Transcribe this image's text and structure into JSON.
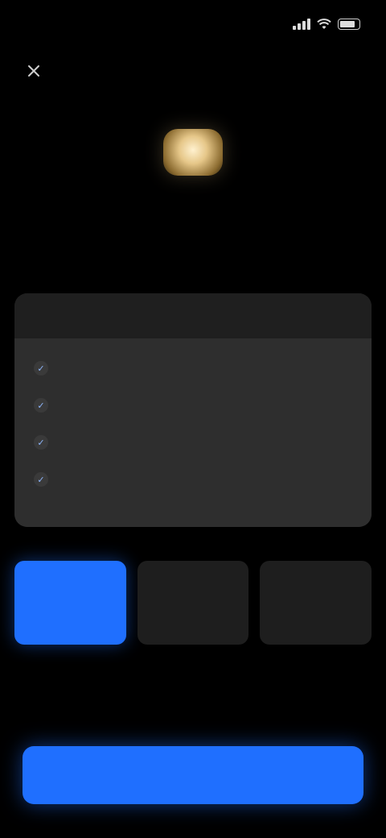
{
  "status_bar": {
    "time": "",
    "signal_bars": 4,
    "battery_level": 0.8
  },
  "nav": {
    "close_icon": "close-icon",
    "title": ""
  },
  "header": {
    "logo_icon": "app-logo-icon",
    "title": "",
    "subtitle": ""
  },
  "benefits": {
    "heading": "",
    "items": [
      {
        "label": ""
      },
      {
        "label": ""
      },
      {
        "label": ""
      },
      {
        "label": ""
      }
    ]
  },
  "plans": [
    {
      "name": "",
      "price": "",
      "selected": true
    },
    {
      "name": "",
      "price": "",
      "selected": false
    },
    {
      "name": "",
      "price": "",
      "selected": false
    }
  ],
  "cta": {
    "label": ""
  },
  "colors": {
    "background": "#000000",
    "accent": "#1f6fff",
    "card": "#2e2e2e",
    "logo": "#e6c789"
  }
}
